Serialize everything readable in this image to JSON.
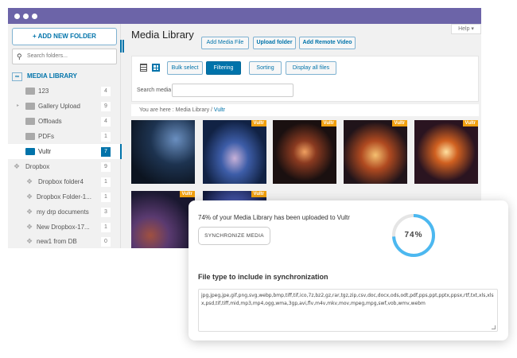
{
  "sidebar": {
    "add_folder": "+ ADD NEW FOLDER",
    "search_placeholder": "Search folders...",
    "root": "MEDIA LIBRARY",
    "items": [
      {
        "label": "123",
        "count": "4"
      },
      {
        "label": "Gallery Upload",
        "count": "9"
      },
      {
        "label": "Offloads",
        "count": "4"
      },
      {
        "label": "PDFs",
        "count": "1"
      },
      {
        "label": "Vultr",
        "count": "7"
      }
    ],
    "dropbox": {
      "label": "Dropbox",
      "count": "9"
    },
    "dropbox_items": [
      {
        "label": "Dropbox folder4",
        "count": "1"
      },
      {
        "label": "Dropbox Folder-1...",
        "count": "1"
      },
      {
        "label": "my drp documents",
        "count": "3"
      },
      {
        "label": "New Dropbox-17...",
        "count": "1"
      },
      {
        "label": "new1 from DB",
        "count": "0"
      }
    ]
  },
  "main": {
    "title": "Media Library",
    "add_media": "Add Media File",
    "upload_folder": "Upload folder",
    "add_remote": "Add Remote Video",
    "help": "Help ▾",
    "bulk": "Bulk select",
    "filtering": "Filtering",
    "sorting": "Sorting",
    "display_all": "Display all files",
    "search_label": "Search media",
    "breadcrumb": {
      "prefix": "You are here  :  Media Library  /",
      "current": "Vultr"
    },
    "tag": "Vultr"
  },
  "sync": {
    "message": "74% of your Media Library has been uploaded to Vultr",
    "button": "SYNCHRONIZE MEDIA",
    "percent": 74,
    "percent_label": "74%",
    "filetype_title": "File type to include in synchronization",
    "filetypes": "jpg,jpeg,jpe,gif,png,svg,webp,bmp,tiff,tif,ico,7z,bz2,gz,rar,tgz,zip,csv,doc,docx,ods,odt,pdf,pps,ppt,pptx,ppsx,rtf,txt,xls,xlsx,psd,tif,tiff,mid,mp3,mp4,ogg,wma,3gp,avi,flv,m4v,mkv,mov,mpeg,mpg,swf,vob,wmv,webm"
  }
}
